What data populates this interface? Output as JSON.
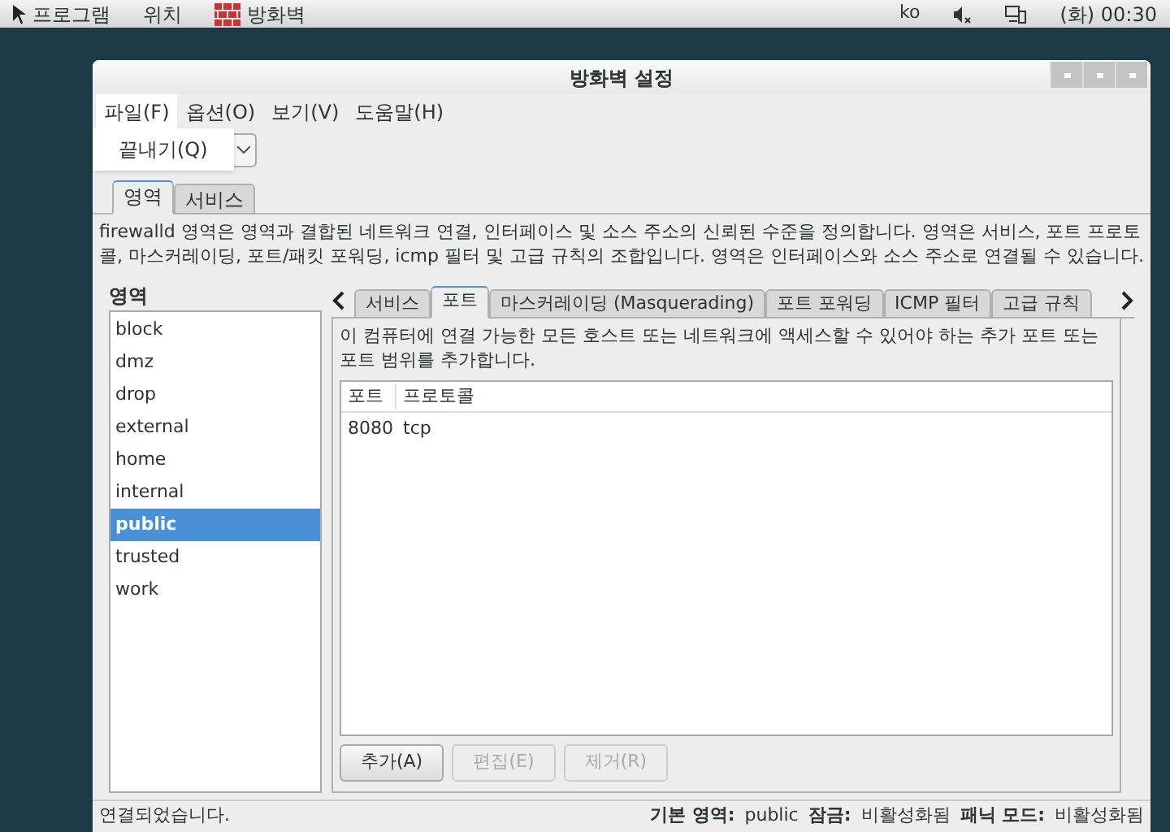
{
  "top_panel": {
    "menus": [
      "프로그램",
      "위치",
      "방화벽"
    ],
    "language": "ko",
    "clock": "(화) 00:30"
  },
  "window": {
    "title": "방화벽 설정"
  },
  "menubar": [
    {
      "label": "파일(F)",
      "selected": true
    },
    {
      "label": "옵션(O)",
      "selected": false
    },
    {
      "label": "보기(V)",
      "selected": false
    },
    {
      "label": "도움말(H)",
      "selected": false
    }
  ],
  "file_menu": {
    "items": [
      "끝내기(Q)"
    ]
  },
  "main_tabs": [
    {
      "label": "영역",
      "selected": true
    },
    {
      "label": "서비스",
      "selected": false
    }
  ],
  "description": "firewalld 영역은 영역과 결합된 네트워크 연결, 인터페이스 및 소스 주소의 신뢰된 수준을 정의합니다. 영역은 서비스, 포트 프로토콜, 마스커레이딩, 포트/패킷 포워딩, icmp 필터 및 고급 규칙의 조합입니다. 영역은 인터페이스와 소스 주소로 연결될 수 있습니다.",
  "zones": {
    "label": "영역",
    "items": [
      {
        "name": "block",
        "selected": false
      },
      {
        "name": "dmz",
        "selected": false
      },
      {
        "name": "drop",
        "selected": false
      },
      {
        "name": "external",
        "selected": false
      },
      {
        "name": "home",
        "selected": false
      },
      {
        "name": "internal",
        "selected": false
      },
      {
        "name": "public",
        "selected": true
      },
      {
        "name": "trusted",
        "selected": false
      },
      {
        "name": "work",
        "selected": false
      }
    ]
  },
  "zone_tabs": [
    {
      "label": "서비스",
      "selected": false
    },
    {
      "label": "포트",
      "selected": true
    },
    {
      "label": "마스커레이딩 (Masquerading)",
      "selected": false
    },
    {
      "label": "포트 포워딩",
      "selected": false
    },
    {
      "label": "ICMP 필터",
      "selected": false
    },
    {
      "label": "고급 규칙",
      "selected": false
    }
  ],
  "ports": {
    "hint": "이 컴퓨터에 연결 가능한 모든 호스트 또는 네트워크에 액세스할 수 있어야 하는 추가 포트 또는 포트 범위를 추가합니다.",
    "columns": [
      "포트",
      "프로토콜"
    ],
    "rows": [
      [
        "8080",
        "tcp"
      ]
    ],
    "buttons": [
      {
        "label": "추가(A)",
        "disabled": false
      },
      {
        "label": "편집(E)",
        "disabled": true
      },
      {
        "label": "제거(R)",
        "disabled": true
      }
    ]
  },
  "status_bar": {
    "message": "연결되었습니다.",
    "fields": [
      {
        "label": "기본 영역:",
        "value": "public"
      },
      {
        "label": "잠금:",
        "value": "비활성화됨"
      },
      {
        "label": "패닉 모드:",
        "value": "비활성화됨"
      }
    ]
  }
}
